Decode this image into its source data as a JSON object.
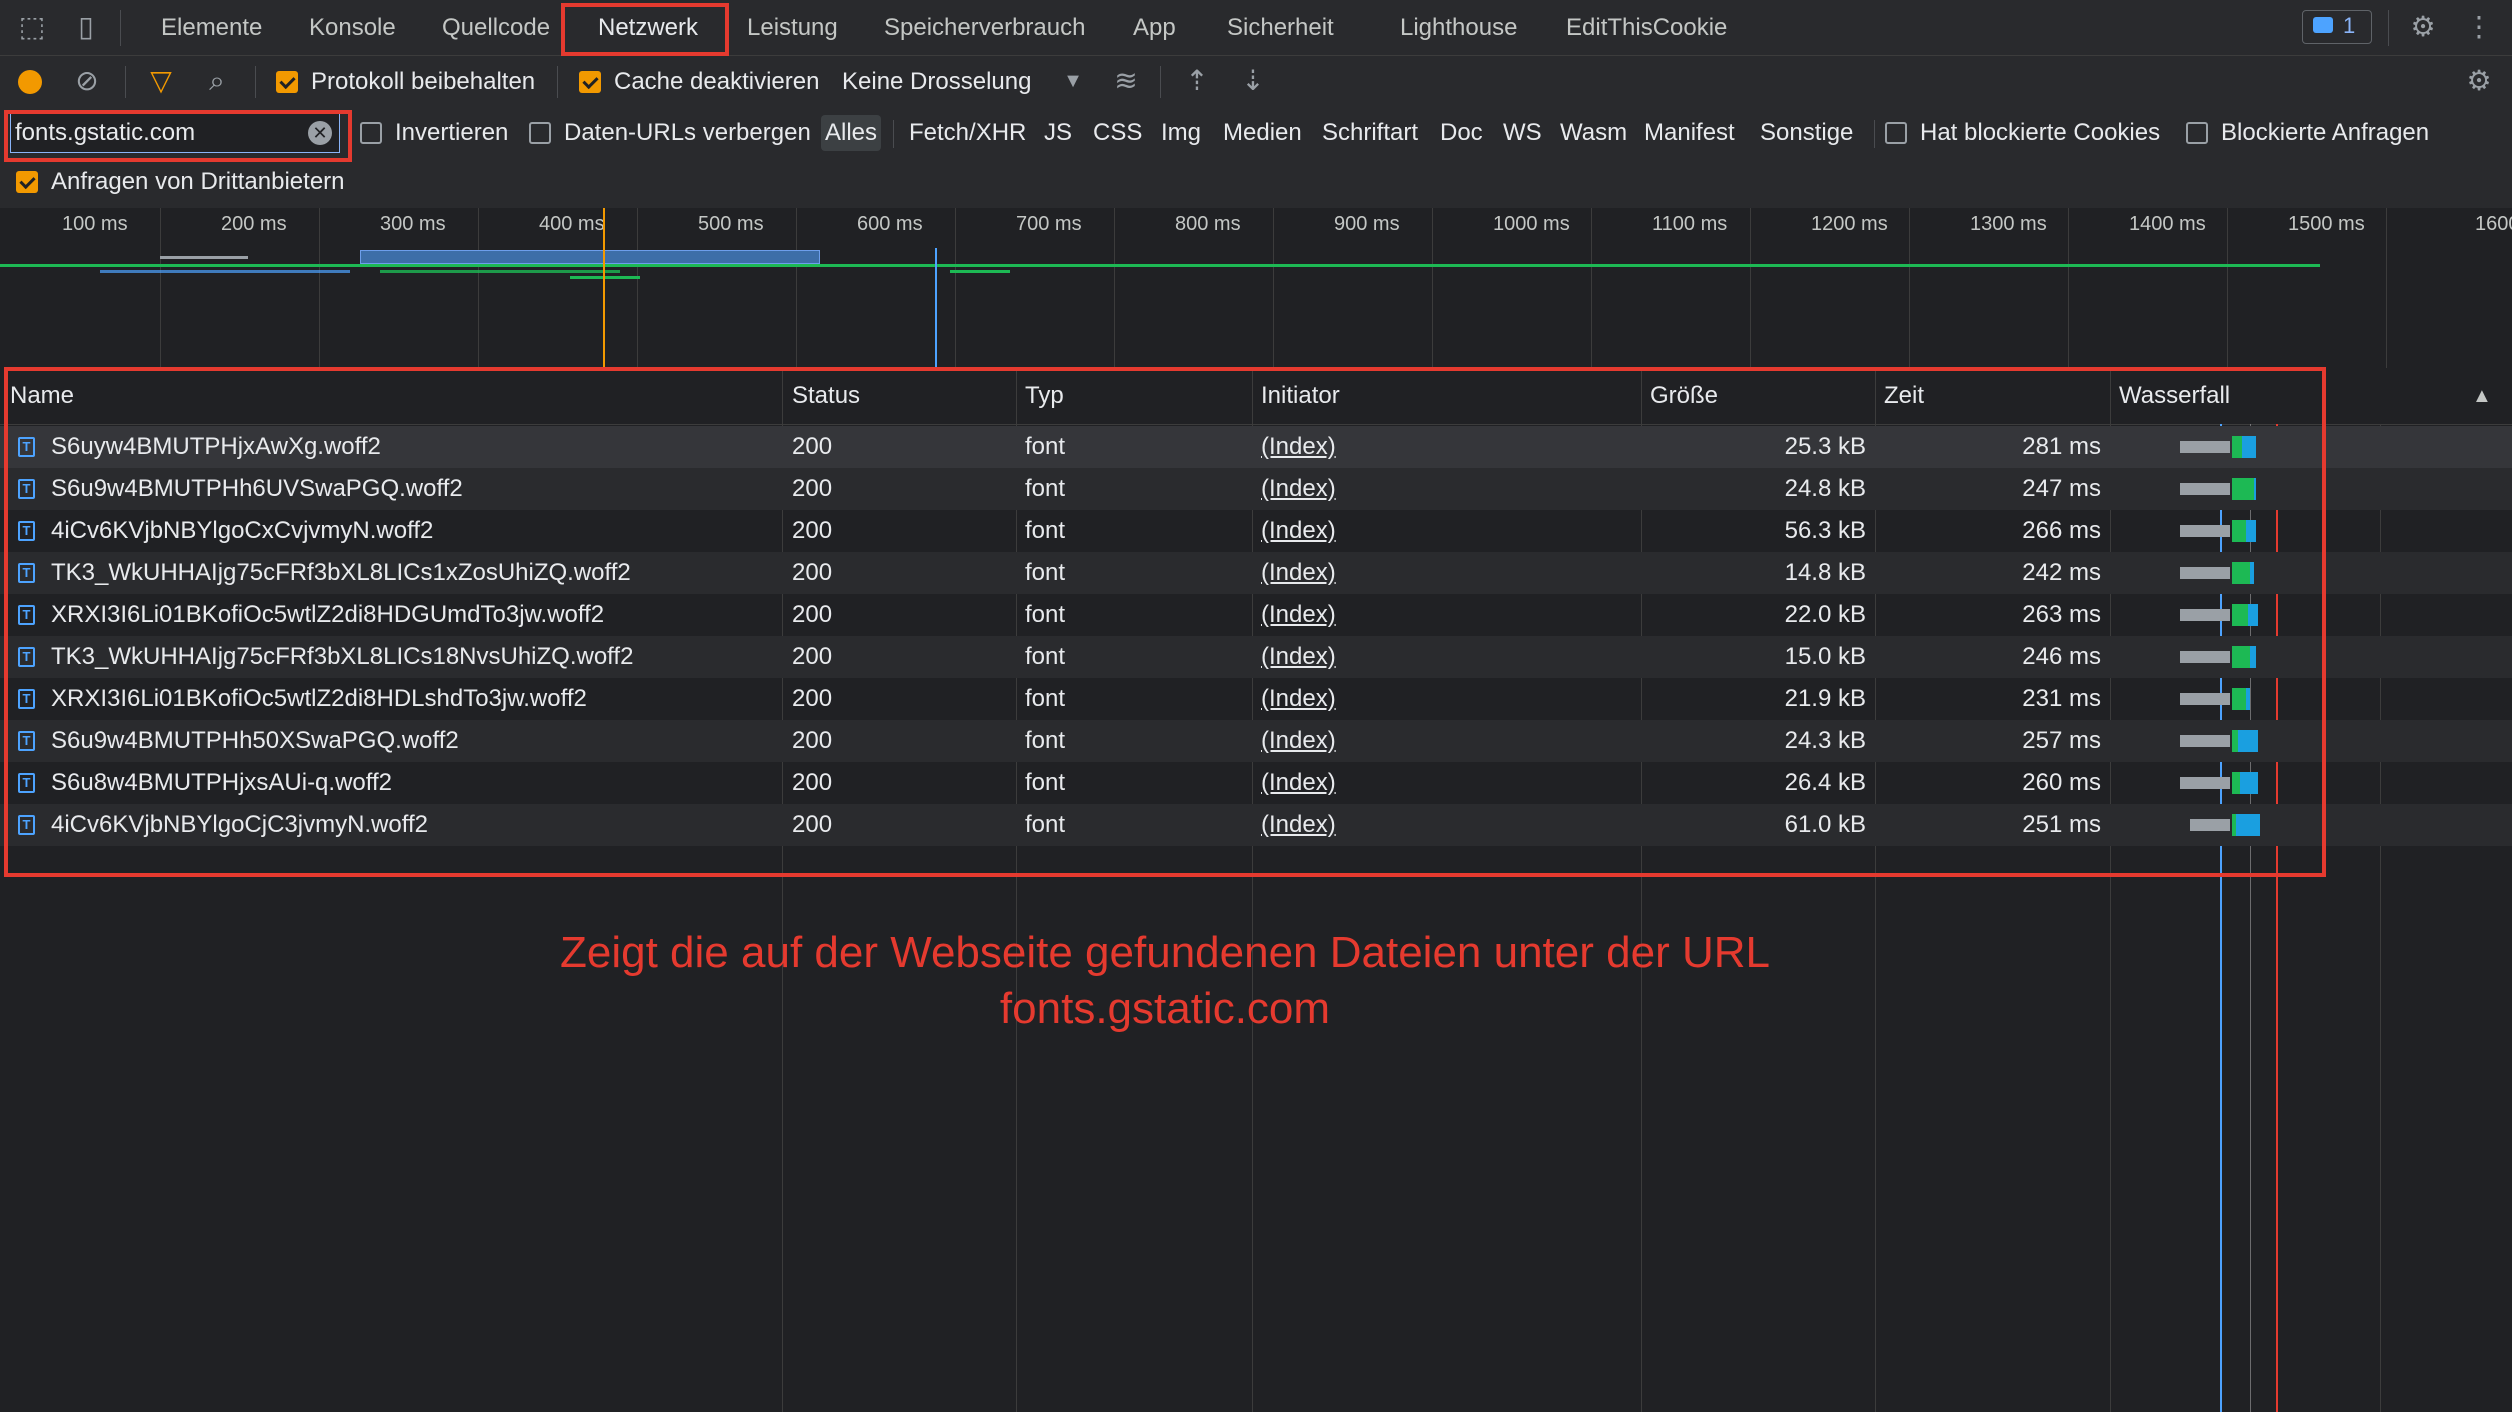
{
  "tabs": [
    {
      "label": "Elemente"
    },
    {
      "label": "Konsole"
    },
    {
      "label": "Quellcode"
    },
    {
      "label": "Netzwerk",
      "active": true
    },
    {
      "label": "Leistung"
    },
    {
      "label": "Speicherverbrauch"
    },
    {
      "label": "App"
    },
    {
      "label": "Sicherheit"
    },
    {
      "label": "Lighthouse"
    },
    {
      "label": "EditThisCookie"
    }
  ],
  "issues_badge": "1",
  "toolbar": {
    "preserve_log": "Protokoll beibehalten",
    "disable_cache": "Cache deaktivieren",
    "throttling": "Keine Drosselung"
  },
  "filter": {
    "value": "fonts.gstatic.com",
    "invert": "Invertieren",
    "hide_data_urls": "Daten-URLs verbergen",
    "types": [
      "Alles",
      "Fetch/XHR",
      "JS",
      "CSS",
      "Img",
      "Medien",
      "Schriftart",
      "Doc",
      "WS",
      "Wasm",
      "Manifest",
      "Sonstige"
    ],
    "blocked_cookies": "Hat blockierte Cookies",
    "blocked_requests": "Blockierte Anfragen",
    "third_party": "Anfragen von Drittanbietern"
  },
  "timeline": {
    "ticks": [
      "100 ms",
      "200 ms",
      "300 ms",
      "400 ms",
      "500 ms",
      "600 ms",
      "700 ms",
      "800 ms",
      "900 ms",
      "1000 ms",
      "1100 ms",
      "1200 ms",
      "1300 ms",
      "1400 ms",
      "1500 ms",
      "1600"
    ]
  },
  "table": {
    "headers": {
      "name": "Name",
      "status": "Status",
      "type": "Typ",
      "initiator": "Initiator",
      "size": "Größe",
      "time": "Zeit",
      "waterfall": "Wasserfall"
    },
    "rows": [
      {
        "name": "S6uyw4BMUTPHjxAwXg.woff2",
        "status": "200",
        "type": "font",
        "initiator": "(Index)",
        "size": "25.3 kB",
        "time": "281 ms"
      },
      {
        "name": "S6u9w4BMUTPHh6UVSwaPGQ.woff2",
        "status": "200",
        "type": "font",
        "initiator": "(Index)",
        "size": "24.8 kB",
        "time": "247 ms"
      },
      {
        "name": "4iCv6KVjbNBYlgoCxCvjvmyN.woff2",
        "status": "200",
        "type": "font",
        "initiator": "(Index)",
        "size": "56.3 kB",
        "time": "266 ms"
      },
      {
        "name": "TK3_WkUHHAIjg75cFRf3bXL8LICs1xZosUhiZQ.woff2",
        "status": "200",
        "type": "font",
        "initiator": "(Index)",
        "size": "14.8 kB",
        "time": "242 ms"
      },
      {
        "name": "XRXI3I6Li01BKofiOc5wtlZ2di8HDGUmdTo3jw.woff2",
        "status": "200",
        "type": "font",
        "initiator": "(Index)",
        "size": "22.0 kB",
        "time": "263 ms"
      },
      {
        "name": "TK3_WkUHHAIjg75cFRf3bXL8LICs18NvsUhiZQ.woff2",
        "status": "200",
        "type": "font",
        "initiator": "(Index)",
        "size": "15.0 kB",
        "time": "246 ms"
      },
      {
        "name": "XRXI3I6Li01BKofiOc5wtlZ2di8HDLshdTo3jw.woff2",
        "status": "200",
        "type": "font",
        "initiator": "(Index)",
        "size": "21.9 kB",
        "time": "231 ms"
      },
      {
        "name": "S6u9w4BMUTPHh50XSwaPGQ.woff2",
        "status": "200",
        "type": "font",
        "initiator": "(Index)",
        "size": "24.3 kB",
        "time": "257 ms"
      },
      {
        "name": "S6u8w4BMUTPHjxsAUi-q.woff2",
        "status": "200",
        "type": "font",
        "initiator": "(Index)",
        "size": "26.4 kB",
        "time": "260 ms"
      },
      {
        "name": "4iCv6KVjbNBYlgoCjC3jvmyN.woff2",
        "status": "200",
        "type": "font",
        "initiator": "(Index)",
        "size": "61.0 kB",
        "time": "251 ms"
      }
    ]
  },
  "annotation": {
    "line1": "Zeigt die auf der Webseite gefundenen Dateien unter der URL",
    "line2": "fonts.gstatic.com"
  },
  "colors": {
    "highlight": "#e53a2f",
    "checkbox": "#f29900",
    "accent": "#8ab4f8"
  }
}
